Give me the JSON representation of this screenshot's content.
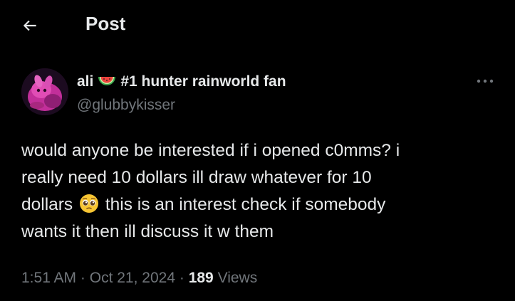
{
  "header": {
    "title": "Post"
  },
  "author": {
    "display_name": "ali",
    "display_name_suffix": "#1 hunter rainworld fan",
    "handle": "@glubbykisser"
  },
  "post": {
    "line1": "would anyone be interested if i opened c0mms? i",
    "line2": "really need 10 dollars ill draw whatever for 10",
    "line3_before_emoji": "dollars",
    "line3_after_emoji": "this is an interest check if somebody",
    "line4": "wants it then ill discuss it w them"
  },
  "meta": {
    "time": "1:51 AM",
    "separator": "·",
    "date": "Oct 21, 2024",
    "views_count": "189",
    "views_label": "Views"
  },
  "icons": {
    "back": "arrow-left-icon",
    "more": "more-horizontal-icon",
    "name_emoji": "watermelon-icon",
    "post_emoji": "pleading-face-icon"
  },
  "colors": {
    "background": "#000000",
    "primary_text": "#e7e9ea",
    "secondary_text": "#71767b"
  }
}
